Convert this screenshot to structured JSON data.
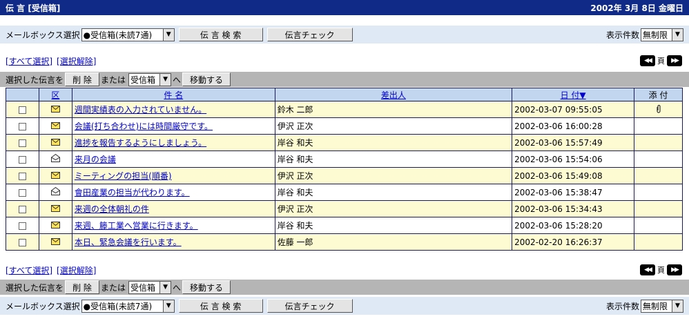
{
  "header": {
    "title": "伝 言 [受信箱]",
    "date": "2002年 3月 8日 金曜日"
  },
  "toolbar": {
    "mailbox_label": "メールボックス選択",
    "mailbox_value": "●受信箱(未読7通)",
    "search_button": "伝 言 検 索",
    "check_button": "伝言チェック",
    "display_count_label": "表示件数",
    "display_count_value": "無制限"
  },
  "selection": {
    "select_all": "[すべて選択]",
    "deselect": "[選択解除]"
  },
  "pager": {
    "label": "頁"
  },
  "actions": {
    "selected_label": "選択した伝言を",
    "delete_button": "削 除",
    "or_label": "または",
    "folder_value": "受信箱",
    "to_label": "へ",
    "move_button": "移動する"
  },
  "table": {
    "headers": {
      "type": "区",
      "subject": "件 名",
      "sender": "差出人",
      "date": "日 付▼",
      "attachment": "添 付"
    },
    "rows": [
      {
        "subject": "週間実績表の入力されていません。",
        "sender": "鈴木 二郎",
        "date": "2002-03-07 09:55:05",
        "icon": "envelope-unread-icon",
        "attachment": true
      },
      {
        "subject": "会議(打ち合わせ)には時間厳守です。",
        "sender": "伊沢 正次",
        "date": "2002-03-06 16:00:28",
        "icon": "envelope-unread-icon",
        "attachment": false
      },
      {
        "subject": "進捗を報告するようにしましょう。",
        "sender": "岸谷 和夫",
        "date": "2002-03-06 15:57:49",
        "icon": "envelope-unread-icon",
        "attachment": false
      },
      {
        "subject": "来月の会議",
        "sender": "岸谷 和夫",
        "date": "2002-03-06 15:54:06",
        "icon": "envelope-read-icon",
        "attachment": false
      },
      {
        "subject": "ミーティングの担当(順番)",
        "sender": "伊沢 正次",
        "date": "2002-03-06 15:49:08",
        "icon": "envelope-unread-icon",
        "attachment": false
      },
      {
        "subject": "會田産業の担当が代わります。",
        "sender": "岸谷 和夫",
        "date": "2002-03-06 15:38:47",
        "icon": "envelope-read-icon",
        "attachment": false
      },
      {
        "subject": "来週の全体朝礼の件",
        "sender": "伊沢 正次",
        "date": "2002-03-06 15:34:43",
        "icon": "envelope-unread-icon",
        "attachment": false
      },
      {
        "subject": "来週、籐工業へ営業に行きます。",
        "sender": "岸谷 和夫",
        "date": "2002-03-06 15:28:20",
        "icon": "envelope-unread-icon",
        "attachment": false
      },
      {
        "subject": "本日、緊急会議を行います。",
        "sender": "佐藤 一郎",
        "date": "2002-02-20 16:26:37",
        "icon": "envelope-unread-icon",
        "attachment": false
      }
    ]
  },
  "colors": {
    "title_bg": "#102a88",
    "toolbar_bg": "#dfe9f6",
    "actionbar_bg": "#b5b5b5",
    "header_bg": "#c3d6ef",
    "row_odd": "#fdfbd2",
    "row_even": "#ffffff",
    "link": "#0000cc"
  }
}
